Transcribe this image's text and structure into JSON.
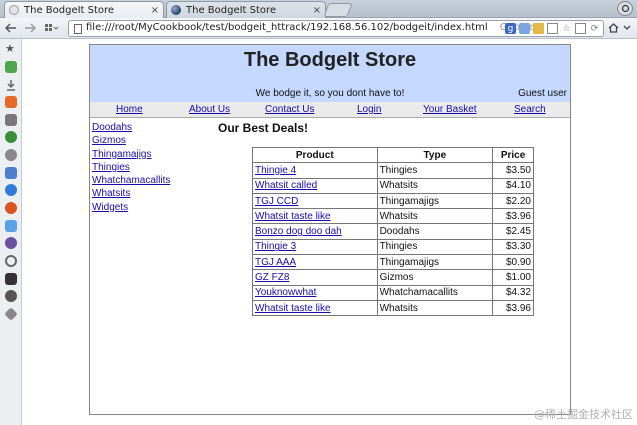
{
  "browser": {
    "tabs": [
      {
        "title": "The BodgeIt Store",
        "close": "×"
      },
      {
        "title": "The BodgeIt Store",
        "close": "×"
      }
    ],
    "url": "file:///root/MyCookbook/test/bodgeit_httrack/192.168.56.102/bodgeit/index.html",
    "search_engine": "Google"
  },
  "store": {
    "title": "The BodgeIt Store",
    "tagline": "We bodge it, so you dont have to!",
    "user": "Guest user",
    "menu": [
      "Home",
      "About Us",
      "Contact Us",
      "Login",
      "Your Basket",
      "Search"
    ],
    "categories": [
      "Doodahs",
      "Gizmos",
      "Thingamajigs",
      "Thingies",
      "Whatchamacallits",
      "Whatsits",
      "Widgets"
    ],
    "deals_title": "Our Best Deals!",
    "columns": [
      "Product",
      "Type",
      "Price"
    ],
    "rows": [
      {
        "product": "Thingie 4",
        "type": "Thingies",
        "price": "$3.50"
      },
      {
        "product": "Whatsit called",
        "type": "Whatsits",
        "price": "$4.10"
      },
      {
        "product": "TGJ CCD",
        "type": "Thingamajigs",
        "price": "$2.20"
      },
      {
        "product": "Whatsit taste like",
        "type": "Whatsits",
        "price": "$3.96"
      },
      {
        "product": "Bonzo dog doo dah",
        "type": "Doodahs",
        "price": "$2.45"
      },
      {
        "product": "Thingie 3",
        "type": "Thingies",
        "price": "$3.30"
      },
      {
        "product": "TGJ AAA",
        "type": "Thingamajigs",
        "price": "$0.90"
      },
      {
        "product": "GZ FZ8",
        "type": "Gizmos",
        "price": "$1.00"
      },
      {
        "product": "Youknowwhat",
        "type": "Whatchamacallits",
        "price": "$4.32"
      },
      {
        "product": "Whatsit taste like",
        "type": "Whatsits",
        "price": "$3.96"
      }
    ]
  },
  "watermark": "@稀土掘金技术社区",
  "icons": {
    "back": "back-arrow-icon",
    "forward": "forward-arrow-icon",
    "apps": "apps-grid-icon",
    "page": "page-icon",
    "star": "star-icon",
    "reload": "reload-icon",
    "home": "home-icon"
  }
}
